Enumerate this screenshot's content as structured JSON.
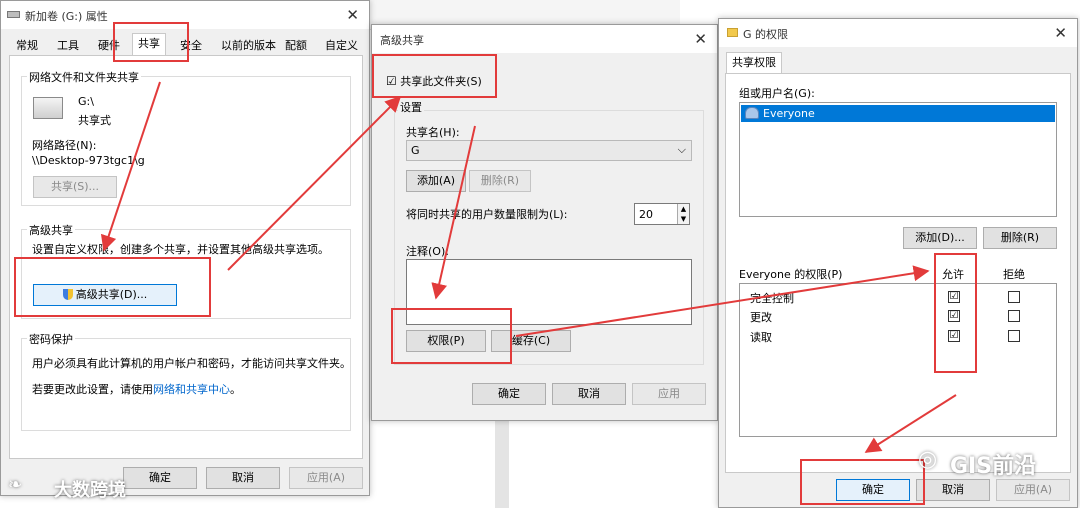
{
  "props": {
    "title": "新加卷 (G:) 属性",
    "tabs": [
      "常规",
      "工具",
      "硬件",
      "共享",
      "安全",
      "以前的版本",
      "配额",
      "自定义"
    ],
    "net_share_group": "网络文件和文件夹共享",
    "drive_name": "G:\\",
    "drive_status": "共享式",
    "net_path_label": "网络路径(N):",
    "net_path_value": "\\\\Desktop-973tgc1\\g",
    "share_btn": "共享(S)...",
    "adv_group": "高级共享",
    "adv_desc": "设置自定义权限，创建多个共享，并设置其他高级共享选项。",
    "adv_btn": "高级共享(D)...",
    "pwd_group": "密码保护",
    "pwd_desc": "用户必须具有此计算机的用户帐户和密码，才能访问共享文件夹。",
    "pwd_change_prefix": "若要更改此设置，请使用",
    "pwd_link": "网络和共享中心",
    "pwd_change_suffix": "。",
    "ok": "确定",
    "cancel": "取消",
    "apply": "应用(A)"
  },
  "adv": {
    "title": "高级共享",
    "share_check_label": "共享此文件夹(S)",
    "share_checked": "☑",
    "settings_label": "设置",
    "share_name_label": "共享名(H):",
    "share_name_value": "G",
    "add_btn": "添加(A)",
    "remove_btn": "删除(R)",
    "limit_label": "将同时共享的用户数量限制为(L):",
    "limit_value": "20",
    "comment_label": "注释(O):",
    "perm_btn": "权限(P)",
    "cache_btn": "缓存(C)",
    "ok": "确定",
    "cancel": "取消",
    "apply": "应用"
  },
  "perm": {
    "title": "G 的权限",
    "tab": "共享权限",
    "group_label": "组或用户名(G):",
    "user": "Everyone",
    "add_btn": "添加(D)...",
    "remove_btn": "删除(R)",
    "perm_label": "Everyone 的权限(P)",
    "allow_label": "允许",
    "deny_label": "拒绝",
    "rows": [
      {
        "name": "完全控制",
        "allow": "☑",
        "deny": "☐"
      },
      {
        "name": "更改",
        "allow": "☑",
        "deny": "☐"
      },
      {
        "name": "读取",
        "allow": "☑",
        "deny": "☐"
      }
    ],
    "ok": "确定",
    "cancel": "取消",
    "apply": "应用(A)"
  },
  "watermarks": {
    "left": "大数跨境",
    "right": "GIS前沿"
  },
  "colors": {
    "annotation": "#e23b3b",
    "selection": "#0078d7",
    "link": "#0066cc"
  },
  "icons": [
    "drive-icon",
    "shield-icon",
    "users-icon",
    "folder-icon",
    "close-icon",
    "dropdown-icon",
    "spinner-icon"
  ]
}
